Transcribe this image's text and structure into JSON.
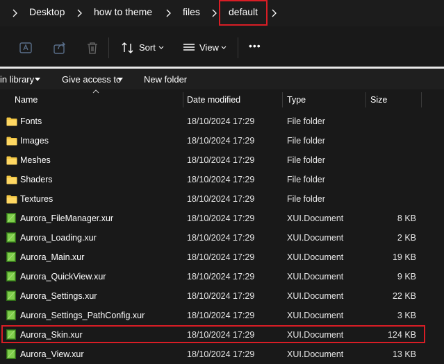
{
  "breadcrumb": {
    "items": [
      "Desktop",
      "how to theme",
      "files",
      "default"
    ]
  },
  "toolbar": {
    "sort_label": "Sort",
    "view_label": "View",
    "more_label": "•••",
    "icons": [
      "rename-icon",
      "share-icon",
      "delete-icon",
      "sort-icon",
      "view-icon",
      "more-icon"
    ]
  },
  "ribbon": {
    "include_label": "in library",
    "give_access_label": "Give access to",
    "new_folder_label": "New folder"
  },
  "columns": {
    "name": "Name",
    "date": "Date modified",
    "type": "Type",
    "size": "Size"
  },
  "files": [
    {
      "name": "Fonts",
      "date": "18/10/2024 17:29",
      "type": "File folder",
      "size": "",
      "icon": "folder-icon"
    },
    {
      "name": "Images",
      "date": "18/10/2024 17:29",
      "type": "File folder",
      "size": "",
      "icon": "folder-icon"
    },
    {
      "name": "Meshes",
      "date": "18/10/2024 17:29",
      "type": "File folder",
      "size": "",
      "icon": "folder-icon"
    },
    {
      "name": "Shaders",
      "date": "18/10/2024 17:29",
      "type": "File folder",
      "size": "",
      "icon": "folder-icon"
    },
    {
      "name": "Textures",
      "date": "18/10/2024 17:29",
      "type": "File folder",
      "size": "",
      "icon": "folder-icon"
    },
    {
      "name": "Aurora_FileManager.xur",
      "date": "18/10/2024 17:29",
      "type": "XUI.Document",
      "size": "8 KB",
      "icon": "xur-file-icon"
    },
    {
      "name": "Aurora_Loading.xur",
      "date": "18/10/2024 17:29",
      "type": "XUI.Document",
      "size": "2 KB",
      "icon": "xur-file-icon"
    },
    {
      "name": "Aurora_Main.xur",
      "date": "18/10/2024 17:29",
      "type": "XUI.Document",
      "size": "19 KB",
      "icon": "xur-file-icon"
    },
    {
      "name": "Aurora_QuickView.xur",
      "date": "18/10/2024 17:29",
      "type": "XUI.Document",
      "size": "9 KB",
      "icon": "xur-file-icon"
    },
    {
      "name": "Aurora_Settings.xur",
      "date": "18/10/2024 17:29",
      "type": "XUI.Document",
      "size": "22 KB",
      "icon": "xur-file-icon"
    },
    {
      "name": "Aurora_Settings_PathConfig.xur",
      "date": "18/10/2024 17:29",
      "type": "XUI.Document",
      "size": "3 KB",
      "icon": "xur-file-icon"
    },
    {
      "name": "Aurora_Skin.xur",
      "date": "18/10/2024 17:29",
      "type": "XUI.Document",
      "size": "124 KB",
      "icon": "xur-file-icon"
    },
    {
      "name": "Aurora_View.xur",
      "date": "18/10/2024 17:29",
      "type": "XUI.Document",
      "size": "13 KB",
      "icon": "xur-file-icon"
    }
  ],
  "colors": {
    "background": "#191919",
    "highlight": "#d91d25",
    "folder": "#f3c744",
    "xur": "#6cbf3c"
  }
}
